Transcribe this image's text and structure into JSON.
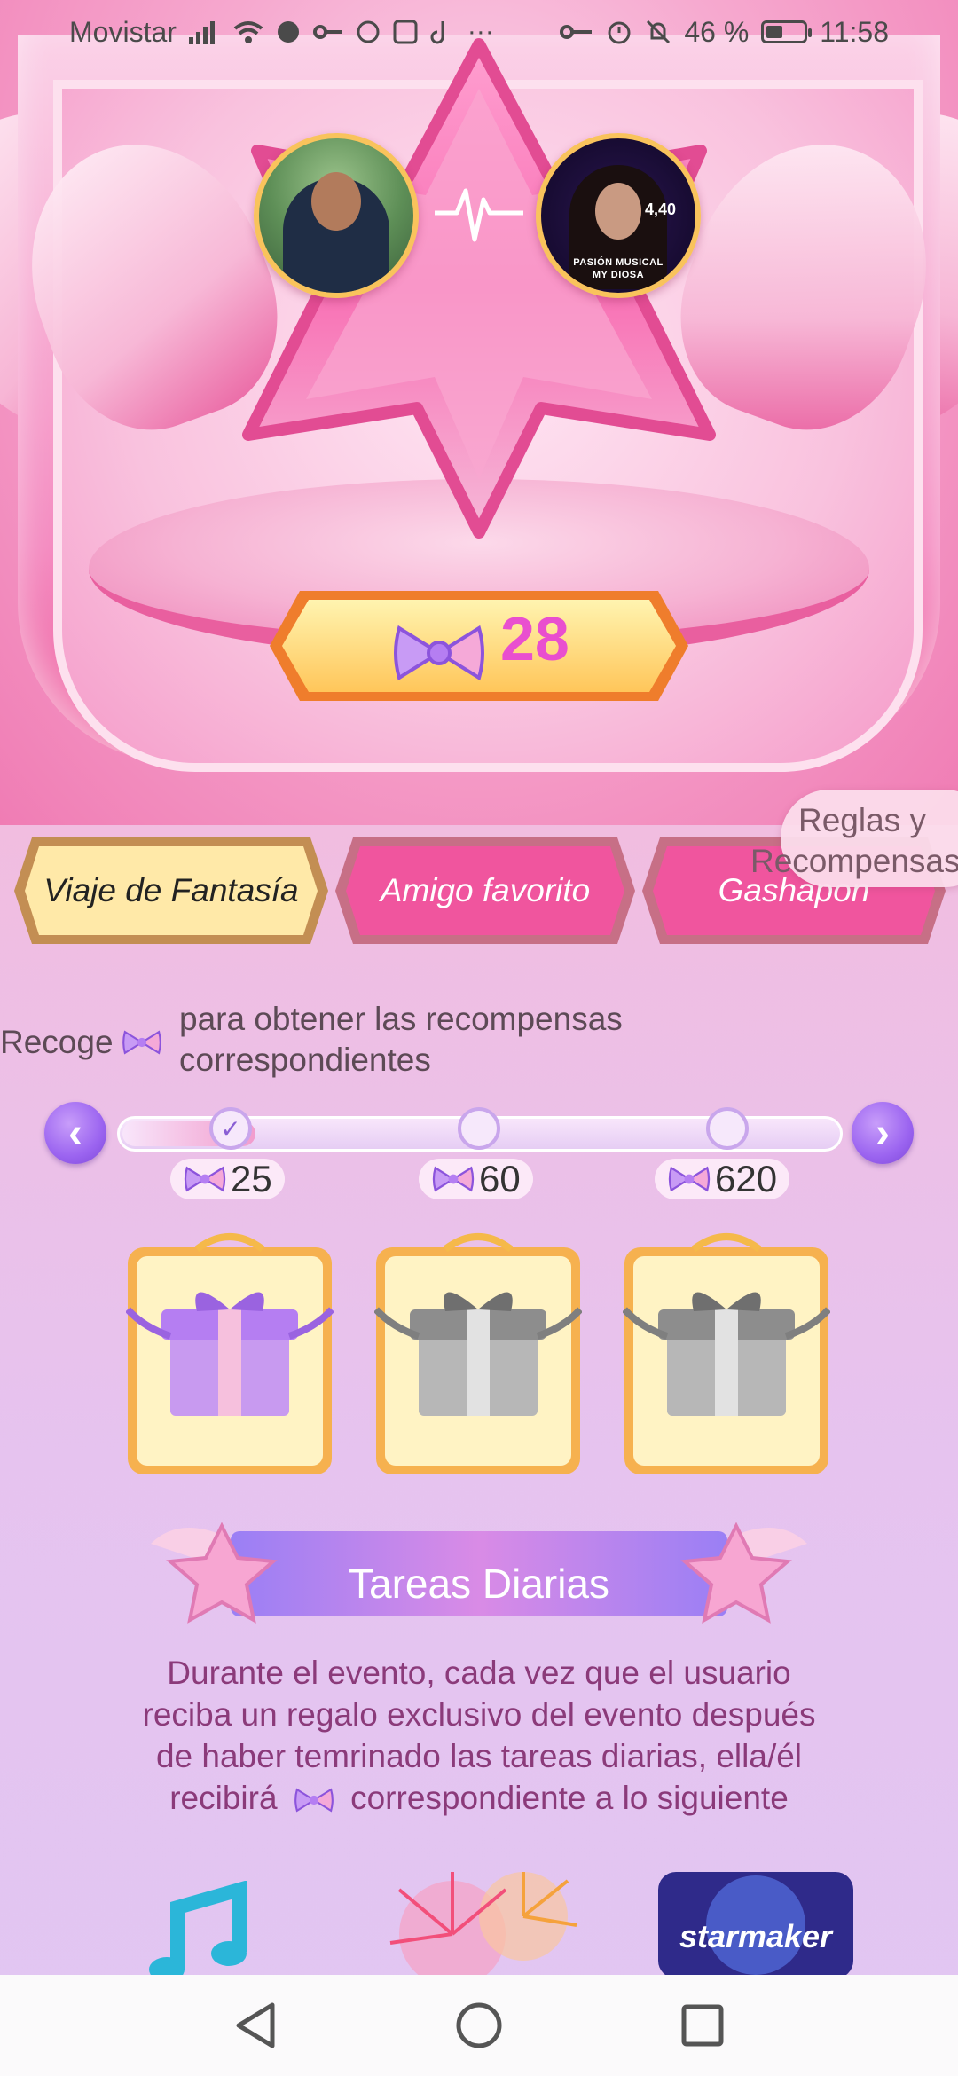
{
  "status_bar": {
    "carrier": "Movistar",
    "battery_percent": "46 %",
    "battery_level": 0.46,
    "time": "11:58",
    "icons": [
      "signal-icon",
      "wifi-icon",
      "vpn-icon",
      "key-icon",
      "whatsapp-icon",
      "app-icon",
      "tiktok-icon",
      "more-icon"
    ],
    "right_icons": [
      "key-icon",
      "alarm-icon",
      "mute-icon"
    ]
  },
  "hero": {
    "bow_count": "28",
    "avatar_right_caption_1": "PASIÓN MUSICAL",
    "avatar_right_caption_2": "MY DIOSA",
    "avatar_right_num": "4,40"
  },
  "rules_button": {
    "line1": "Reglas y",
    "line2": "Recompensas"
  },
  "tabs": [
    {
      "label": "Viaje de Fantasía",
      "active": true
    },
    {
      "label": "Amigo favorito",
      "active": false
    },
    {
      "label": "Gashapon",
      "active": false
    }
  ],
  "collect": {
    "lead": "Recoge",
    "rest_line1": "para obtener las recompensas",
    "rest_line2": "correspondientes"
  },
  "progress": {
    "prev": "‹",
    "next": "›",
    "check": "✓"
  },
  "thresholds": [
    "25",
    "60",
    "620"
  ],
  "daily_tasks": {
    "title": "Tareas Diarias",
    "desc_line1": "Durante el evento, cada vez que el usuario",
    "desc_line2": "reciba un regalo exclusivo del evento después",
    "desc_line3": "de haber temrinado las tareas diarias, ella/él",
    "desc_line4_a": "recibirá",
    "desc_line4_b": "correspondiente a lo siguiente"
  },
  "bottom_icons": {
    "starmaker_label": "starmaker"
  },
  "colors": {
    "accent_pink": "#e94fcf",
    "purple": "#9b64f0",
    "desc_text": "#8b3a7a"
  }
}
